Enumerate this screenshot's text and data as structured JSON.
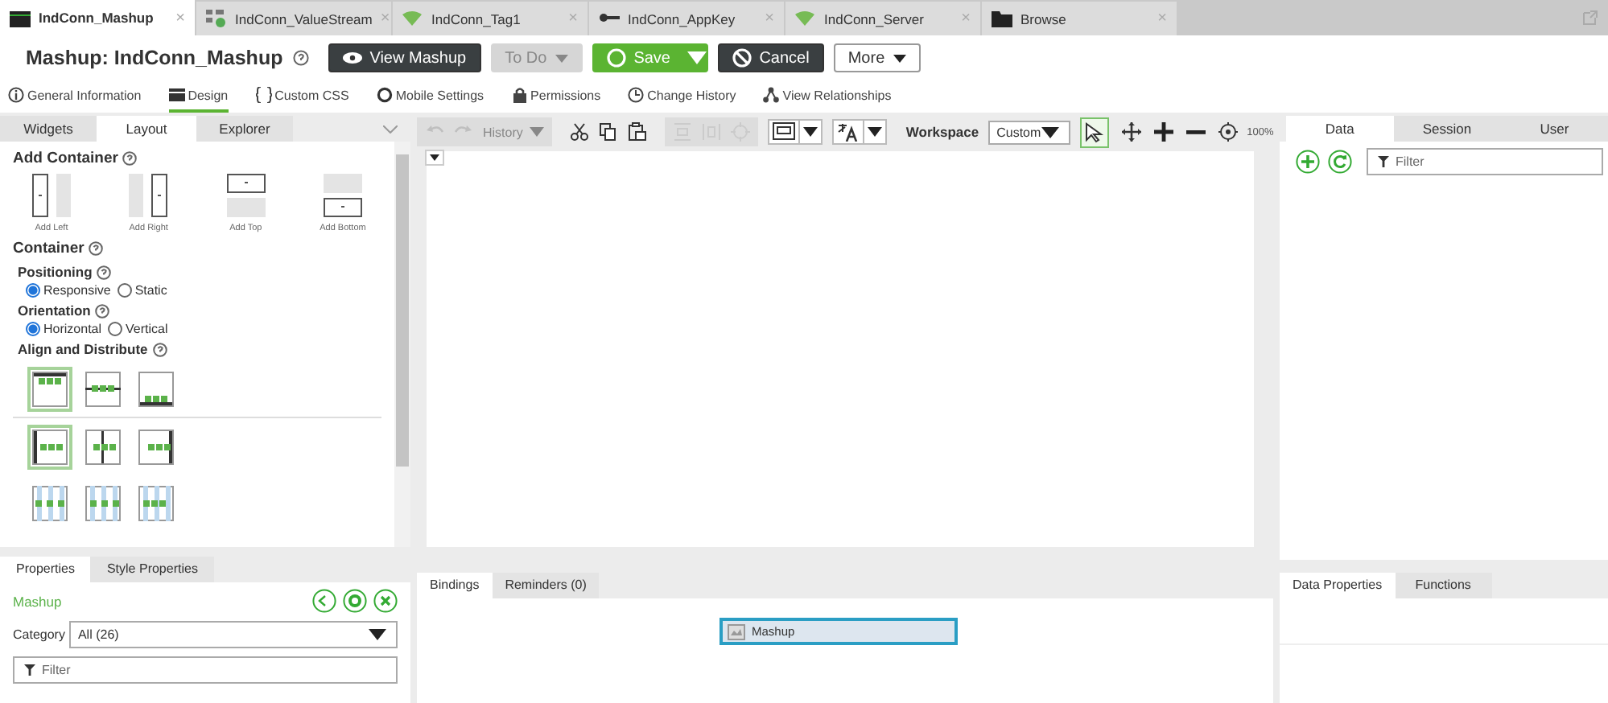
{
  "doc_tabs": [
    {
      "label": "IndConn_Mashup",
      "selected": true
    },
    {
      "label": "IndConn_ValueStream",
      "selected": false
    },
    {
      "label": "IndConn_Tag1",
      "selected": false
    },
    {
      "label": "IndConn_AppKey",
      "selected": false
    },
    {
      "label": "IndConn_Server",
      "selected": false
    },
    {
      "label": "Browse",
      "selected": false
    }
  ],
  "close_glyph": "×",
  "header": {
    "title": "Mashup: IndConn_Mashup",
    "buttons": [
      {
        "kind": "view",
        "label": "View Mashup",
        "disabled": false
      },
      {
        "kind": "todo",
        "label": "To Do",
        "disabled": true
      },
      {
        "kind": "save",
        "label": "Save",
        "disabled": false
      },
      {
        "kind": "cancel",
        "label": "Cancel",
        "disabled": false
      },
      {
        "kind": "more",
        "label": "More",
        "disabled": false
      }
    ]
  },
  "sub_nav": [
    {
      "label": "General Information",
      "selected": false
    },
    {
      "label": "Design",
      "selected": true
    },
    {
      "label": "Custom CSS",
      "selected": false
    },
    {
      "label": "Mobile Settings",
      "selected": false
    },
    {
      "label": "Permissions",
      "selected": false
    },
    {
      "label": "Change History",
      "selected": false
    },
    {
      "label": "View Relationships",
      "selected": false
    }
  ],
  "left_panel": {
    "tabs": [
      {
        "label": "Widgets",
        "selected": false
      },
      {
        "label": "Layout",
        "selected": true
      },
      {
        "label": "Explorer",
        "selected": false
      }
    ],
    "add_container": {
      "title": "Add Container",
      "items": [
        "Add Left",
        "Add Right",
        "Add Top",
        "Add Bottom"
      ]
    },
    "container_title": "Container",
    "positioning": {
      "label": "Positioning",
      "options": [
        {
          "label": "Responsive",
          "selected": true
        },
        {
          "label": "Static",
          "selected": false
        }
      ]
    },
    "orientation": {
      "label": "Orientation",
      "options": [
        {
          "label": "Horizontal",
          "selected": true
        },
        {
          "label": "Vertical",
          "selected": false
        }
      ]
    },
    "align_title": "Align and Distribute",
    "align_rows": [
      [
        {
          "selected": true
        },
        {
          "selected": false
        },
        {
          "selected": false
        }
      ],
      [
        {
          "selected": true
        },
        {
          "selected": false
        },
        {
          "selected": false
        }
      ],
      [
        {
          "selected": false
        },
        {
          "selected": false
        },
        {
          "selected": false
        }
      ]
    ]
  },
  "toolbar": {
    "history": "History",
    "tools": [
      {
        "disabled": true
      },
      {
        "disabled": true
      },
      {
        "disabled": false
      },
      {
        "disabled": false
      },
      {
        "disabled": false
      },
      {
        "disabled": true
      },
      {
        "disabled": true
      },
      {
        "disabled": true
      }
    ],
    "workspace_label": "Workspace",
    "workspace_value": "Custom",
    "select_tool_selected": true,
    "zoom": "100%"
  },
  "right_panel": {
    "tabs": [
      {
        "label": "Data",
        "selected": true
      },
      {
        "label": "Session",
        "selected": false
      },
      {
        "label": "User",
        "selected": false
      }
    ],
    "filter_placeholder": "Filter"
  },
  "properties": {
    "tabs": [
      {
        "label": "Properties",
        "selected": true
      },
      {
        "label": "Style Properties",
        "selected": false
      }
    ],
    "object": "Mashup",
    "category_label": "Category",
    "category_value": "All (26)",
    "filter_placeholder": "Filter"
  },
  "bindings": {
    "tabs": [
      {
        "label": "Bindings",
        "selected": true
      },
      {
        "label": "Reminders (0)",
        "selected": false
      }
    ],
    "node": {
      "label": "Mashup",
      "selected": true
    }
  },
  "data_properties": {
    "tabs": [
      {
        "label": "Data Properties",
        "selected": true
      },
      {
        "label": "Functions",
        "selected": false
      }
    ]
  }
}
